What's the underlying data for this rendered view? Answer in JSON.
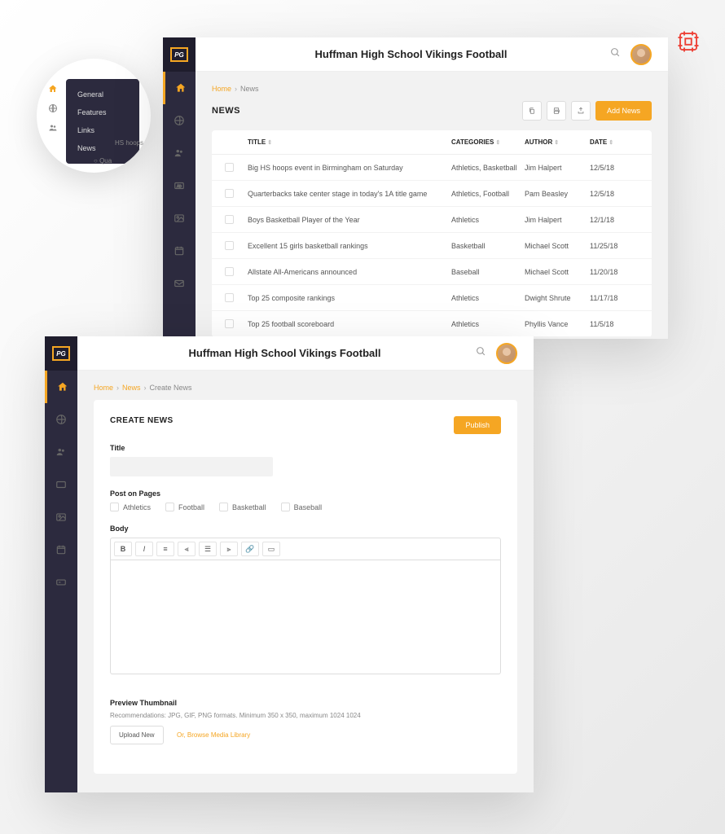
{
  "header": {
    "title": "Huffman High School Vikings Football",
    "logo_text": "PG"
  },
  "popover_menu": {
    "items": [
      "General",
      "Features",
      "Links",
      "News"
    ],
    "bubble_hint1": "HS hoops",
    "bubble_hint2": "Qua"
  },
  "breadcrumb1": {
    "home": "Home",
    "current": "News"
  },
  "news_list": {
    "section_title": "NEWS",
    "add_button": "Add News",
    "columns": {
      "title": "TITLE",
      "categories": "CATEGORIES",
      "author": "AUTHOR",
      "date": "DATE"
    },
    "rows": [
      {
        "title": "Big HS hoops event in Birmingham on Saturday",
        "categories": "Athletics, Basketball",
        "author": "Jim Halpert",
        "date": "12/5/18"
      },
      {
        "title": "Quarterbacks take center stage in today's 1A title game",
        "categories": "Athletics, Football",
        "author": "Pam Beasley",
        "date": "12/5/18"
      },
      {
        "title": "Boys Basketball Player of the Year",
        "categories": "Athletics",
        "author": "Jim Halpert",
        "date": "12/1/18"
      },
      {
        "title": "Excellent 15 girls basketball rankings",
        "categories": "Basketball",
        "author": "Michael Scott",
        "date": "11/25/18"
      },
      {
        "title": "Allstate All-Americans announced",
        "categories": "Baseball",
        "author": "Michael Scott",
        "date": "11/20/18"
      },
      {
        "title": "Top 25 composite rankings",
        "categories": "Athletics",
        "author": "Dwight Shrute",
        "date": "11/17/18"
      },
      {
        "title": "Top 25 football scoreboard",
        "categories": "Athletics",
        "author": "Phyllis Vance",
        "date": "11/5/18"
      }
    ]
  },
  "breadcrumb2": {
    "home": "Home",
    "news": "News",
    "current": "Create News"
  },
  "create_news": {
    "form_title": "CREATE NEWS",
    "publish_button": "Publish",
    "title_label": "Title",
    "post_on_label": "Post on Pages",
    "page_options": [
      "Athletics",
      "Football",
      "Basketball",
      "Baseball"
    ],
    "body_label": "Body",
    "thumbnail_label": "Preview Thumbnail",
    "thumbnail_hint": "Recommendations: JPG, GIF, PNG formats. Minimum 350 x 350, maximum 1024 1024",
    "upload_button": "Upload New",
    "browse_link": "Or, Browse Media Library"
  }
}
